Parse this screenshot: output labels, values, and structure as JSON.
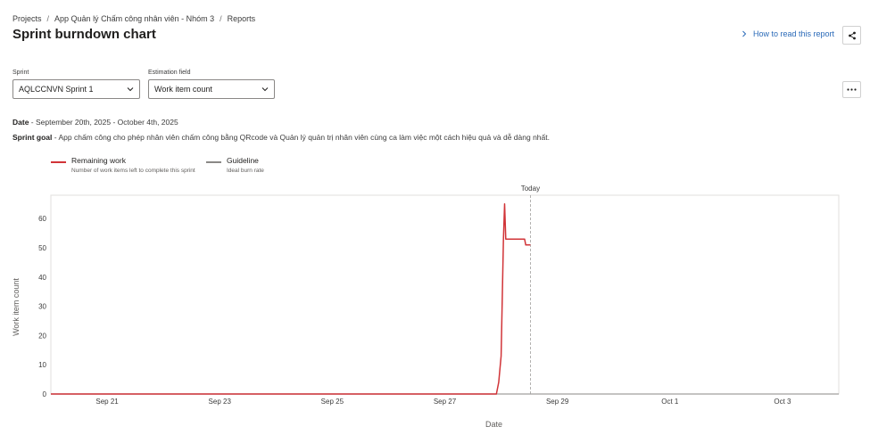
{
  "breadcrumb": [
    "Projects",
    "App Quản lý Chấm công nhân viên - Nhóm 3",
    "Reports"
  ],
  "page_title": "Sprint burndown chart",
  "how_to_read": "How to read this report",
  "sprint": {
    "label": "Sprint",
    "value": "AQLCCNVN Sprint 1"
  },
  "estimation": {
    "label": "Estimation field",
    "value": "Work item count"
  },
  "date_info": {
    "label": "Date",
    "value": " - September 20th, 2025 - October 4th, 2025"
  },
  "sprint_goal": {
    "label": "Sprint goal",
    "value": " - App chấm công cho phép nhân viên chấm công bằng QRcode và Quản lý quản trị nhân viên cùng ca làm việc một cách hiệu quả và dễ dàng nhất."
  },
  "legend": [
    {
      "title": "Remaining work",
      "subtitle": "Number of work items left to complete this sprint",
      "color": "#d13438"
    },
    {
      "title": "Guideline",
      "subtitle": "Ideal burn rate",
      "color": "#8a8886"
    }
  ],
  "icons": {
    "share": "share-icon",
    "more": "more-icon",
    "chevron": "chevron-right-icon",
    "dropdown": "chevron-down-icon"
  },
  "chart_data": {
    "type": "line",
    "xlabel": "Date",
    "ylabel": "Work item count",
    "ylim": [
      0,
      68
    ],
    "yticks": [
      0,
      10,
      20,
      30,
      40,
      50,
      60
    ],
    "xlim": [
      "2025-09-20",
      "2025-10-04"
    ],
    "xticks": [
      "Sep 21",
      "Sep 23",
      "Sep 25",
      "Sep 27",
      "Sep 29",
      "Oct 1",
      "Oct 3"
    ],
    "today": {
      "label": "Today",
      "x": "2025-09-28 12:30"
    },
    "series": [
      {
        "name": "Remaining work",
        "color": "#d13438",
        "points": [
          [
            "2025-09-20 00:00",
            0
          ],
          [
            "2025-09-27 22:00",
            0
          ],
          [
            "2025-09-27 23:00",
            4
          ],
          [
            "2025-09-28 00:00",
            13
          ],
          [
            "2025-09-28 01:00",
            53
          ],
          [
            "2025-09-28 01:30",
            65
          ],
          [
            "2025-09-28 02:00",
            53
          ],
          [
            "2025-09-28 10:00",
            53
          ],
          [
            "2025-09-28 10:30",
            51
          ],
          [
            "2025-09-28 12:30",
            51
          ]
        ]
      }
    ]
  }
}
